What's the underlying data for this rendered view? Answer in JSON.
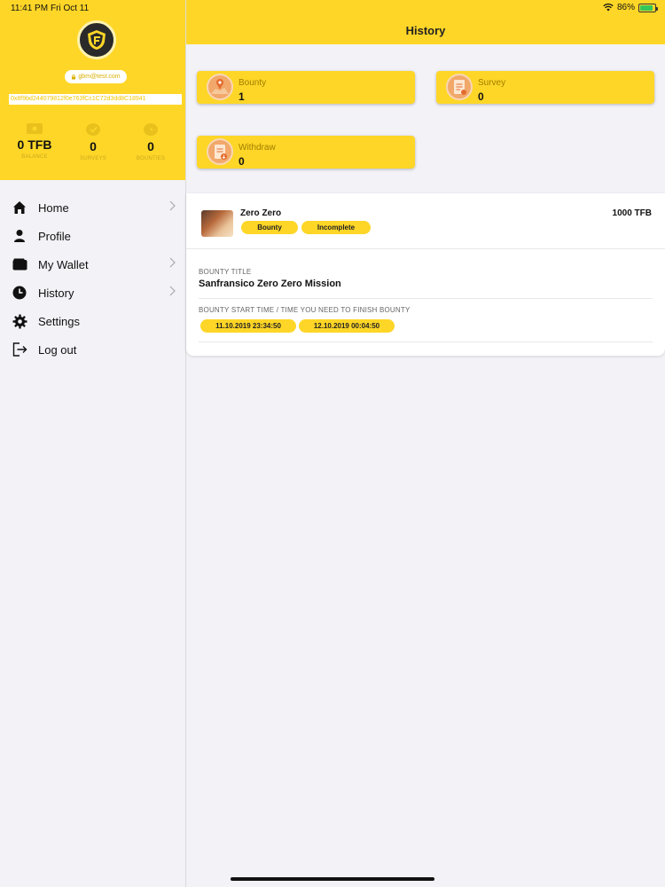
{
  "status_bar": {
    "time": "11:41 PM",
    "date": "Fri Oct 11",
    "battery": "86%"
  },
  "profile": {
    "email": "gbm@test.com",
    "wallet_address": "0x8f9bd244079812f0e763fCc1C72d3dd8C18941",
    "stats": [
      {
        "value": "0 TFB",
        "label": "BALANCE",
        "icon": "money-icon"
      },
      {
        "value": "0",
        "label": "SURVEYS",
        "icon": "check-icon"
      },
      {
        "value": "0",
        "label": "BOUNTIES",
        "icon": "clock-icon"
      }
    ]
  },
  "menu": [
    {
      "label": "Home",
      "icon": "home-icon",
      "chevron": true
    },
    {
      "label": "Profile",
      "icon": "user-icon",
      "chevron": false
    },
    {
      "label": "My Wallet",
      "icon": "wallet-icon",
      "chevron": true
    },
    {
      "label": "History",
      "icon": "clock-icon",
      "chevron": true
    },
    {
      "label": "Settings",
      "icon": "gear-icon",
      "chevron": false
    },
    {
      "label": "Log out",
      "icon": "logout-icon",
      "chevron": false
    }
  ],
  "header": {
    "title": "History"
  },
  "summary": {
    "bounty": {
      "label": "Bounty",
      "value": "1",
      "icon": "map-pin-icon"
    },
    "survey": {
      "label": "Survey",
      "value": "0",
      "icon": "survey-icon"
    },
    "withdraw": {
      "label": "Withdraw",
      "value": "0",
      "icon": "withdraw-icon"
    }
  },
  "history_item": {
    "title": "Zero Zero",
    "amount": "1000 TFB",
    "type": "Bounty",
    "status": "Incomplete",
    "bounty_title_label": "BOUNTY TITLE",
    "bounty_title": "Sanfransico Zero Zero Mission",
    "time_label": "BOUNTY START TIME / TIME YOU NEED TO FINISH BOUNTY",
    "start_time": "11.10.2019 23:34:50",
    "end_time": "12.10.2019 00:04:50"
  },
  "colors": {
    "accent": "#fed627",
    "background": "#f2f2f7"
  }
}
